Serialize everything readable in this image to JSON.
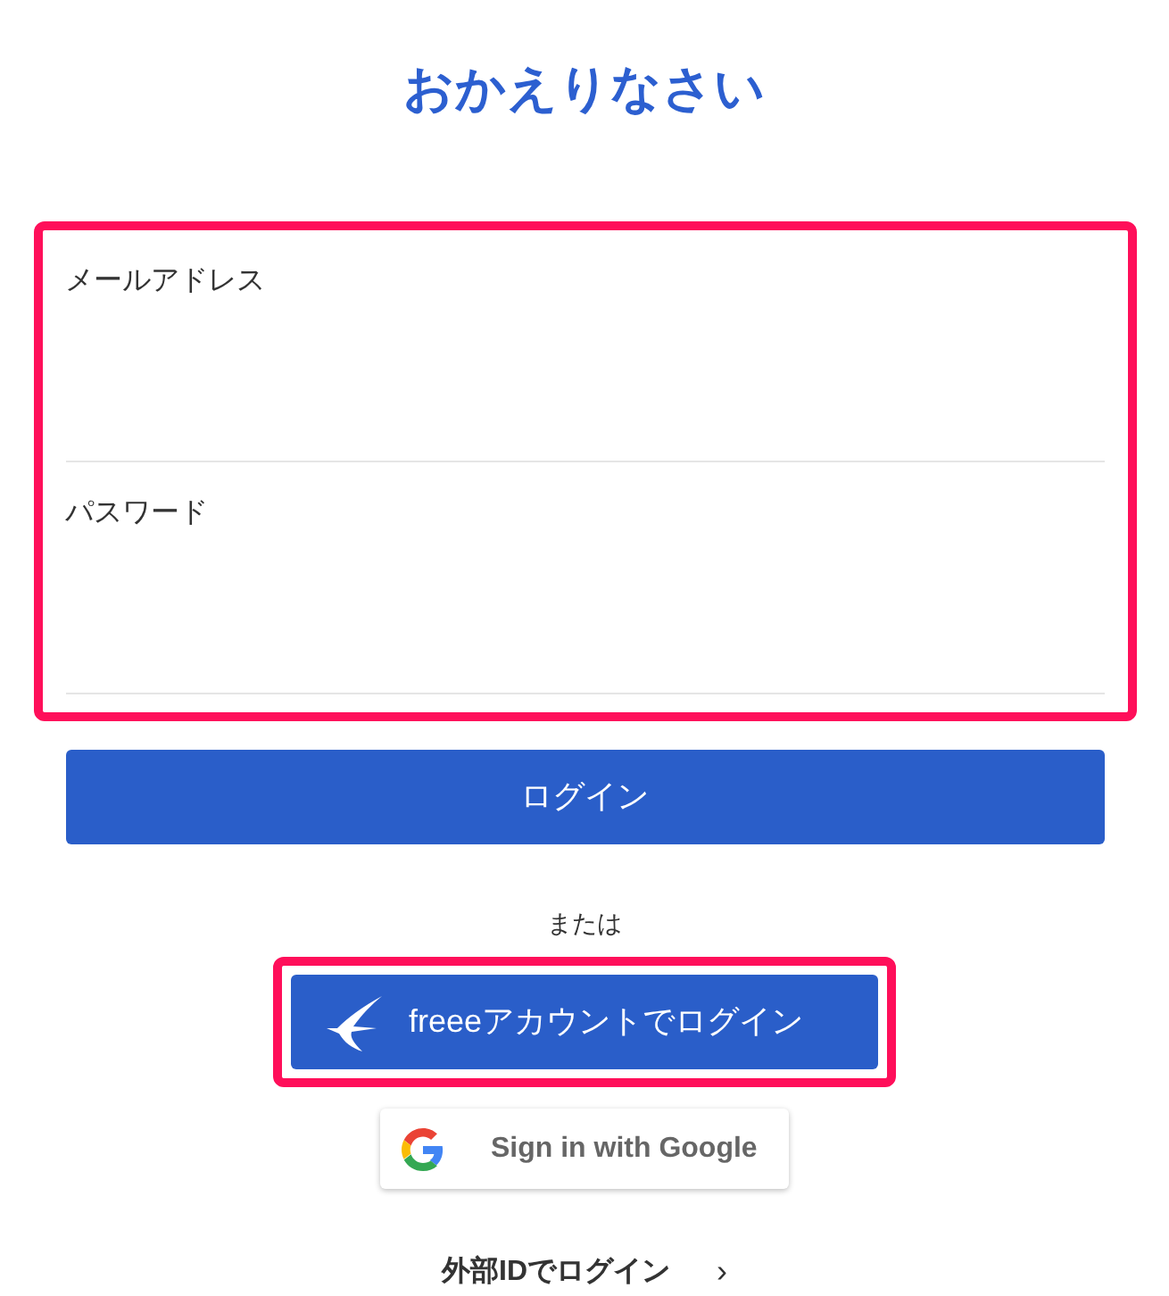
{
  "title": "おかえりなさい",
  "form": {
    "highlighted": true,
    "fields": [
      {
        "label": "メールアドレス"
      },
      {
        "label": "パスワード"
      }
    ]
  },
  "login_button": "ログイン",
  "separator": "または",
  "freee_button": {
    "label": "freeeアカウントでログイン",
    "highlighted": true
  },
  "google_button": "Sign in with Google",
  "external_link": {
    "label": "外部IDでログイン",
    "arrow": "›"
  }
}
